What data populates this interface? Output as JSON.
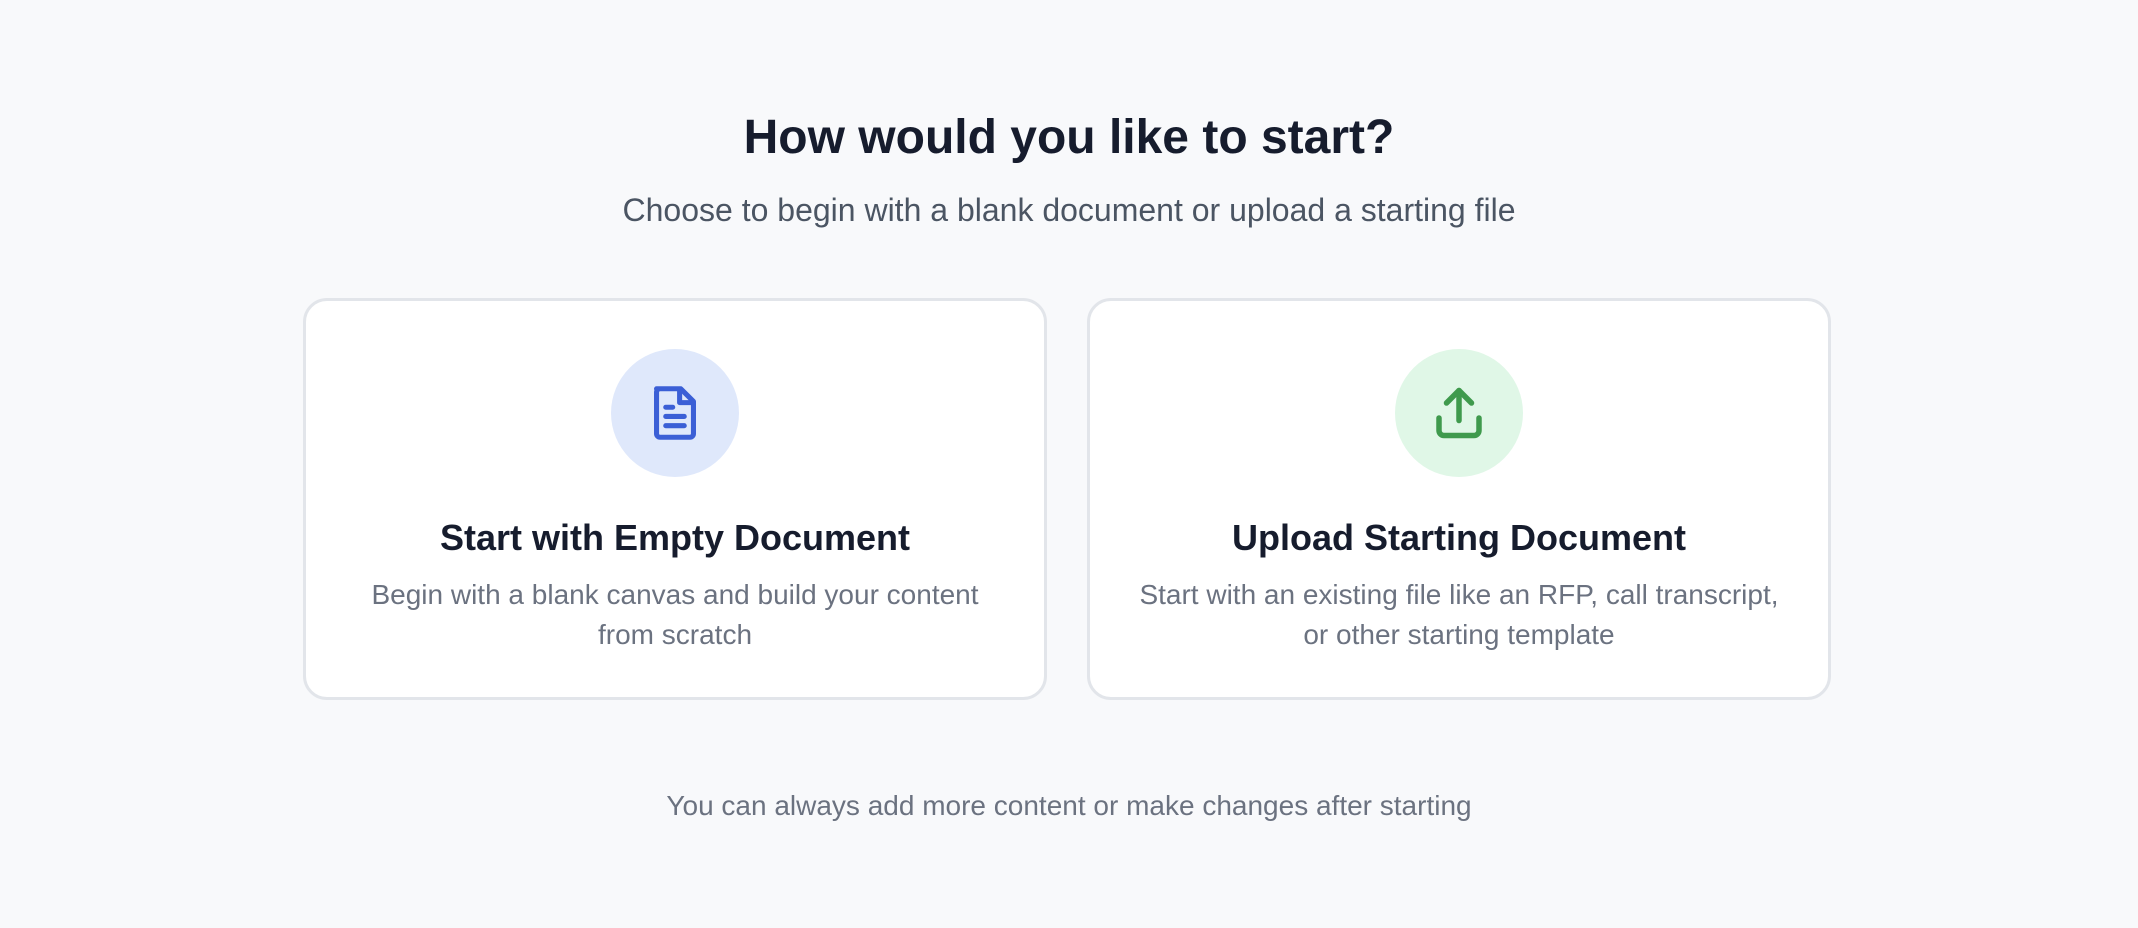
{
  "header": {
    "title": "How would you like to start?",
    "subtitle": "Choose to begin with a blank document or upload a starting file"
  },
  "options": [
    {
      "icon": "document-icon",
      "icon_color": "#3b5fd6",
      "icon_bg": "#dfe8fb",
      "title": "Start with Empty Document",
      "description": "Begin with a blank canvas and build your content from scratch"
    },
    {
      "icon": "upload-icon",
      "icon_color": "#3f9a4d",
      "icon_bg": "#e0f7e7",
      "title": "Upload Starting Document",
      "description": "Start with an existing file like an RFP, call transcript, or other starting template"
    }
  ],
  "footer": {
    "note": "You can always add more content or make changes after starting"
  }
}
